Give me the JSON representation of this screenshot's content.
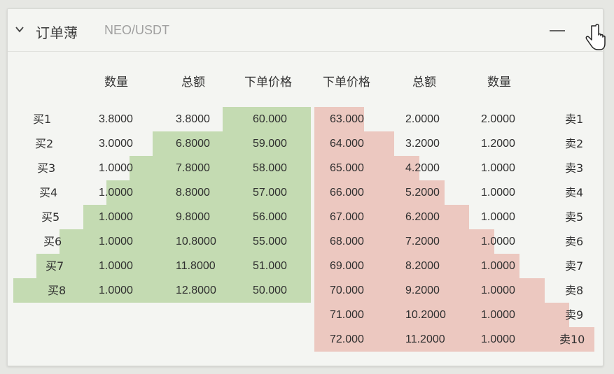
{
  "header": {
    "title": "订单薄",
    "pair": "NEO/USDT",
    "minimize_symbol": "—"
  },
  "columns": [
    "数量",
    "总额",
    "下单价格",
    "下单价格",
    "总额",
    "数量"
  ],
  "colors": {
    "buy_depth": "#c4dbb2",
    "sell_depth": "#ecc8c0"
  },
  "bids": [
    {
      "label": "买1",
      "qty": "3.8000",
      "total": "3.8000",
      "price": "60.000",
      "depth": 3.8
    },
    {
      "label": "买2",
      "qty": "3.0000",
      "total": "6.8000",
      "price": "59.000",
      "depth": 6.8
    },
    {
      "label": "买3",
      "qty": "1.0000",
      "total": "7.8000",
      "price": "58.000",
      "depth": 7.8
    },
    {
      "label": "买4",
      "qty": "1.0000",
      "total": "8.8000",
      "price": "57.000",
      "depth": 8.8
    },
    {
      "label": "买5",
      "qty": "1.0000",
      "total": "9.8000",
      "price": "56.000",
      "depth": 9.8
    },
    {
      "label": "买6",
      "qty": "1.0000",
      "total": "10.8000",
      "price": "55.000",
      "depth": 10.8
    },
    {
      "label": "买7",
      "qty": "1.0000",
      "total": "11.8000",
      "price": "51.000",
      "depth": 11.8
    },
    {
      "label": "买8",
      "qty": "1.0000",
      "total": "12.8000",
      "price": "50.000",
      "depth": 12.8
    }
  ],
  "asks": [
    {
      "label": "卖1",
      "price": "63.000",
      "total": "2.0000",
      "qty": "2.0000",
      "depth": 2.0
    },
    {
      "label": "卖2",
      "price": "64.000",
      "total": "3.2000",
      "qty": "1.2000",
      "depth": 3.2
    },
    {
      "label": "卖3",
      "price": "65.000",
      "total": "4.2000",
      "qty": "1.0000",
      "depth": 4.2
    },
    {
      "label": "卖4",
      "price": "66.000",
      "total": "5.2000",
      "qty": "1.0000",
      "depth": 5.2
    },
    {
      "label": "卖5",
      "price": "67.000",
      "total": "6.2000",
      "qty": "1.0000",
      "depth": 6.2
    },
    {
      "label": "卖6",
      "price": "68.000",
      "total": "7.2000",
      "qty": "1.0000",
      "depth": 7.2
    },
    {
      "label": "卖7",
      "price": "69.000",
      "total": "8.2000",
      "qty": "1.0000",
      "depth": 8.2
    },
    {
      "label": "卖8",
      "price": "70.000",
      "total": "9.2000",
      "qty": "1.0000",
      "depth": 9.2
    },
    {
      "label": "卖9",
      "price": "71.000",
      "total": "10.2000",
      "qty": "1.0000",
      "depth": 10.2
    },
    {
      "label": "卖10",
      "price": "72.000",
      "total": "11.2000",
      "qty": "1.0000",
      "depth": 11.2
    }
  ]
}
